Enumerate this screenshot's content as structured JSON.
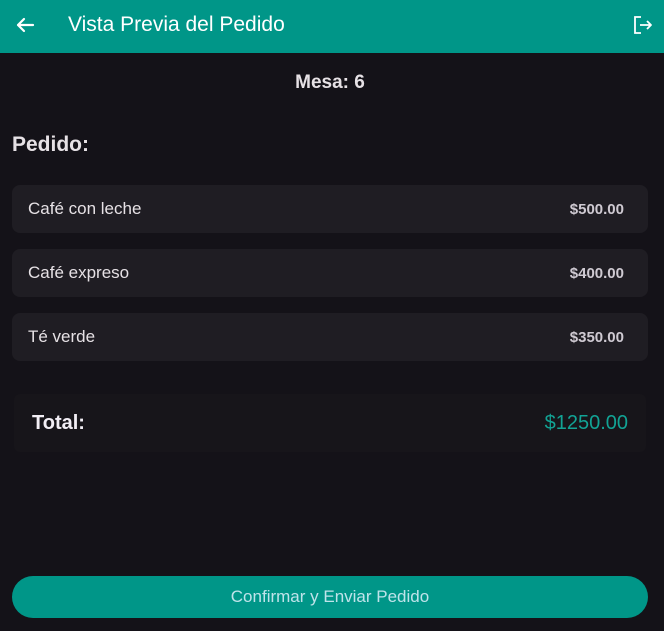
{
  "appbar": {
    "title": "Vista Previa del Pedido",
    "back_icon": "arrow-left-icon",
    "logout_icon": "logout-icon",
    "color": "#009688"
  },
  "mesa": "Mesa: 6",
  "pedido": {
    "title": "Pedido:",
    "items": [
      {
        "name": "Café con leche",
        "price": "$500.00"
      },
      {
        "name": "Café expreso",
        "price": "$400.00"
      },
      {
        "name": "Té verde",
        "price": "$350.00"
      }
    ]
  },
  "total": {
    "label": "Total:",
    "value": "$1250.00"
  },
  "confirm_button": {
    "label": "Confirmar y Enviar Pedido"
  }
}
